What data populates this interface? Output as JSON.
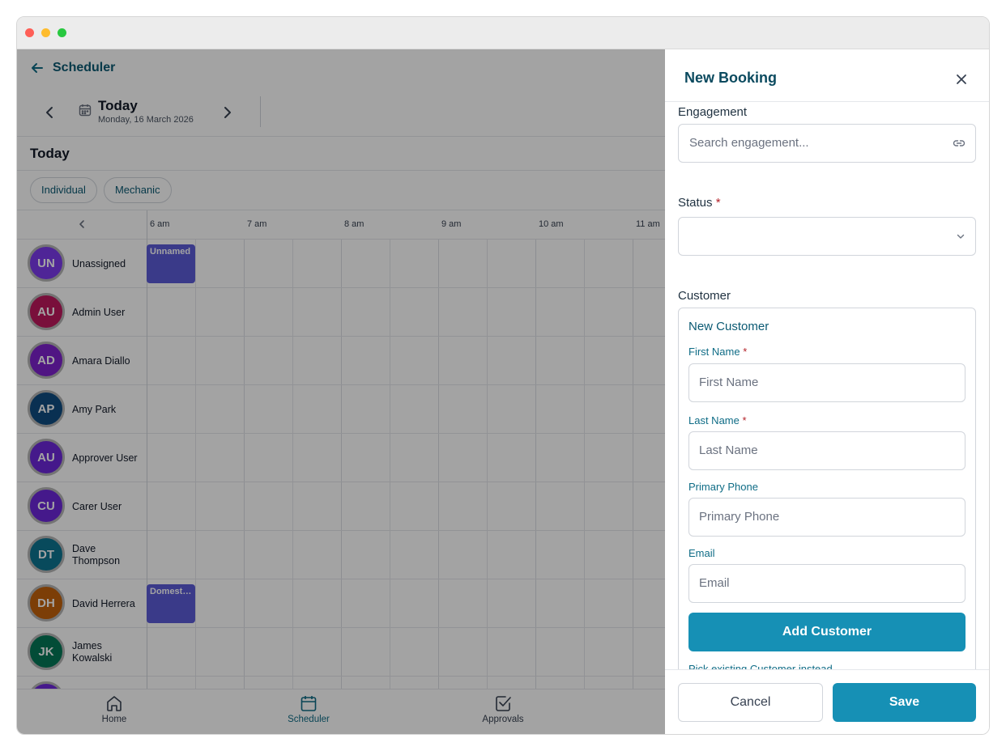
{
  "scheduler": {
    "back_title": "Scheduler",
    "date_title": "Today",
    "date_subtitle": "Monday, 16 March 2026",
    "section_title": "Today",
    "filters": [
      "Individual",
      "Mechanic"
    ],
    "hours": [
      "6 am",
      "7 am",
      "8 am",
      "9 am",
      "10 am",
      "11 am"
    ],
    "rows": [
      {
        "initials": "UN",
        "name": "Unassigned",
        "color": "#7c3aed"
      },
      {
        "initials": "AU",
        "name": "Admin User",
        "color": "#be185d"
      },
      {
        "initials": "AD",
        "name": "Amara Diallo",
        "color": "#7e22ce"
      },
      {
        "initials": "AP",
        "name": "Amy Park",
        "color": "#0f4c81"
      },
      {
        "initials": "AU",
        "name": "Approver User",
        "color": "#6d28d9"
      },
      {
        "initials": "CU",
        "name": "Carer User",
        "color": "#6d28d9"
      },
      {
        "initials": "DT",
        "name": "Dave Thompson",
        "color": "#0e7490"
      },
      {
        "initials": "DH",
        "name": "David Herrera",
        "color": "#c2620c"
      },
      {
        "initials": "JK",
        "name": "James Kowalski",
        "color": "#047857"
      }
    ],
    "events": [
      {
        "label": "Unnamed",
        "row": 0
      },
      {
        "label": "Domest…",
        "row": 7
      }
    ]
  },
  "nav": {
    "home": "Home",
    "scheduler": "Scheduler",
    "approvals": "Approvals"
  },
  "drawer": {
    "title": "New Booking",
    "engagement_label": "Engagement",
    "engagement_placeholder": "Search engagement...",
    "status_label": "Status",
    "customer_label": "Customer",
    "new_customer_title": "New Customer",
    "first_name_label": "First Name",
    "first_name_placeholder": "First Name",
    "last_name_label": "Last Name",
    "last_name_placeholder": "Last Name",
    "phone_label": "Primary Phone",
    "phone_placeholder": "Primary Phone",
    "email_label": "Email",
    "email_placeholder": "Email",
    "add_customer": "Add Customer",
    "pick_existing": "Pick existing Customer instead",
    "cancel": "Cancel",
    "save": "Save"
  },
  "colors": {
    "accent": "#1690b5",
    "event": "#5b5bd6",
    "required": "#b4232a"
  }
}
